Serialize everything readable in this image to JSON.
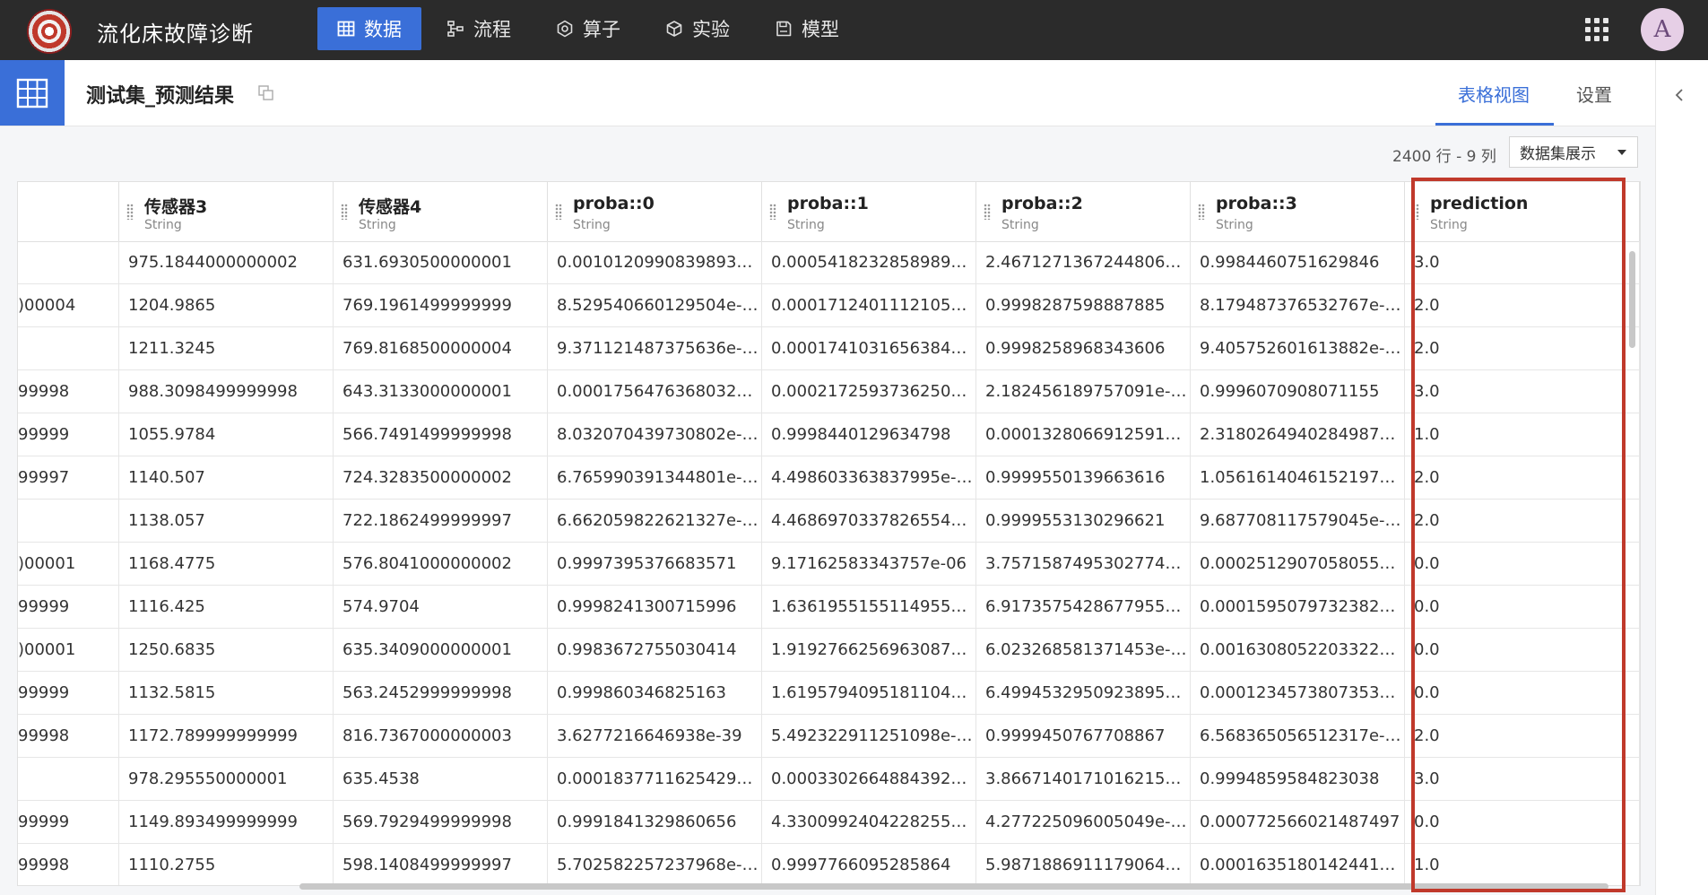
{
  "app": {
    "title": "流化床故障诊断"
  },
  "nav": [
    {
      "label": "数据",
      "icon": "table-icon",
      "active": true
    },
    {
      "label": "流程",
      "icon": "flow-icon",
      "active": false
    },
    {
      "label": "算子",
      "icon": "operator-icon",
      "active": false
    },
    {
      "label": "实验",
      "icon": "cube-icon",
      "active": false
    },
    {
      "label": "模型",
      "icon": "save-icon",
      "active": false
    }
  ],
  "user": {
    "avatar_letter": "A"
  },
  "dataset": {
    "title": "测试集_预测结果"
  },
  "tabs": {
    "table_view": "表格视图",
    "settings": "设置"
  },
  "toolbar": {
    "row_col_count": "2400 行 - 9 列",
    "view_mode": "数据集展示"
  },
  "table": {
    "columns": [
      {
        "name": "",
        "type": ""
      },
      {
        "name": "传感器3",
        "type": "String"
      },
      {
        "name": "传感器4",
        "type": "String"
      },
      {
        "name": "proba::0",
        "type": "String"
      },
      {
        "name": "proba::1",
        "type": "String"
      },
      {
        "name": "proba::2",
        "type": "String"
      },
      {
        "name": "proba::3",
        "type": "String"
      },
      {
        "name": "prediction",
        "type": "String"
      }
    ],
    "rows": [
      [
        "",
        "975.1844000000002",
        "631.6930500000001",
        "0.0010120990839893775",
        "0.0005418232858989673",
        "2.4671271367244806e-...",
        "0.9984460751629846",
        "3.0"
      ],
      [
        ")00004",
        "1204.9865",
        "769.1961499999999",
        "8.529540660129504e-38",
        "0.00017124011121053​96",
        "0.9998287598887885",
        "8.179487376532767e-16",
        "2.0"
      ],
      [
        "",
        "1211.3245",
        "769.8168500000004",
        "9.371121487375636e-38",
        "0.000174103165638429...",
        "0.9998258968343606",
        "9.405752601613882e-16",
        "2.0"
      ],
      [
        "99998",
        "988.3098499999998",
        "643.3133000000001",
        "0.000175647636803226...",
        "0.000217259373625061...",
        "2.182456189757091e-09",
        "0.9996070908071155",
        "3.0"
      ],
      [
        "99999",
        "1055.9784",
        "566.7491499999998",
        "8.032070439730802e-11",
        "0.9998440129634798",
        "0.000132806691259187...",
        "2.3180264940284987e-...",
        "1.0"
      ],
      [
        "99997",
        "1140.507",
        "724.3283500000002",
        "6.765990391344801e-40",
        "4.498603363837995e-05",
        "0.9999550139663616",
        "1.0561614046152197e-...",
        "2.0"
      ],
      [
        "",
        "1138.057",
        "722.1862499999997",
        "6.662059822621327e-40",
        "4.4686970337826554e-...",
        "0.9999553130296621",
        "9.687708117579045e-18",
        "2.0"
      ],
      [
        ")00001",
        "1168.4775",
        "576.8041000000002",
        "0.9997395376683571",
        "9.17162583343757e-06",
        "3.7571587495302774e-...",
        "0.00025129070580556​27",
        "0.0"
      ],
      [
        "99999",
        "1116.425",
        "574.9704",
        "0.9998241300715996",
        "1.6361955155114955e-...",
        "6.9173575428677955e-...",
        "0.000159507973238269...",
        "0.0"
      ],
      [
        ")00001",
        "1250.6835",
        "635.3409000000001",
        "0.9983672755030414",
        "1.9192766256963087e-...",
        "6.023268581371453e-16",
        "0.0016308052203322233",
        "0.0"
      ],
      [
        "99999",
        "1132.5815",
        "563.2452999999998",
        "0.999860346825163",
        "1.6195794095181104e-...",
        "6.4994532950923895e-...",
        "0.000123457380735330...",
        "0.0"
      ],
      [
        "99998",
        "1172.789999999999",
        "816.7367000000003",
        "3.6277216646938e-39",
        "5.492322911251098e-05",
        "0.9999450767708867",
        "6.568365056512317e-16",
        "2.0"
      ],
      [
        "",
        "978.295550000001",
        "635.4538",
        "0.000183771162542953...",
        "0.0003302664884392053",
        "3.8667140171016215e-...",
        "0.9994859584823038",
        "3.0"
      ],
      [
        "99999",
        "1149.893499999999",
        "569.7929499999998",
        "0.9991841329860656",
        "4.3300992404228255e-...",
        "4.277225096005049e-14",
        "0.000772566021487497",
        "0.0"
      ],
      [
        "99998",
        "1110.2755",
        "598.1408499999997",
        "5.702582257237968e-10",
        "0.9997766095285864",
        "5.9871886911179064e-...",
        "0.000163518014244197...",
        "1.0"
      ]
    ]
  },
  "colors": {
    "accent": "#3a6fd8",
    "topbar": "#2b2b2b",
    "highlight": "#c0392b"
  }
}
